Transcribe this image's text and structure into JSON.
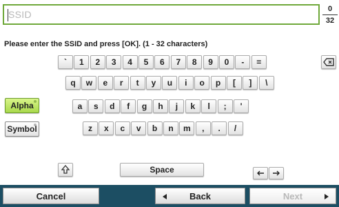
{
  "input": {
    "placeholder": "SSID",
    "value": ""
  },
  "counter": {
    "current": "0",
    "max": "32"
  },
  "instruction": "Please enter the SSID and press [OK]. (1 - 32 characters)",
  "modes": {
    "alpha": "Alpha",
    "symbol": "Symbol"
  },
  "rows": [
    [
      "`",
      "1",
      "2",
      "3",
      "4",
      "5",
      "6",
      "7",
      "8",
      "9",
      "0",
      "-",
      "="
    ],
    [
      "q",
      "w",
      "e",
      "r",
      "t",
      "y",
      "u",
      "i",
      "o",
      "p",
      "[",
      "]",
      "\\"
    ],
    [
      "a",
      "s",
      "d",
      "f",
      "g",
      "h",
      "j",
      "k",
      "l",
      ";",
      "'"
    ],
    [
      "z",
      "x",
      "c",
      "v",
      "b",
      "n",
      "m",
      ",",
      ".",
      "/"
    ]
  ],
  "space_label": "Space",
  "bottom": {
    "cancel": "Cancel",
    "back": "Back",
    "next": "Next"
  },
  "icons": {
    "backspace": "backspace-icon",
    "shift": "shift-icon",
    "arrow_left": "arrow-left-icon",
    "arrow_right": "arrow-right-icon"
  },
  "colors": {
    "active_mode": "#b4df5a",
    "bottom_bar": "#1c4e63",
    "input_border": "#6fa83a"
  }
}
